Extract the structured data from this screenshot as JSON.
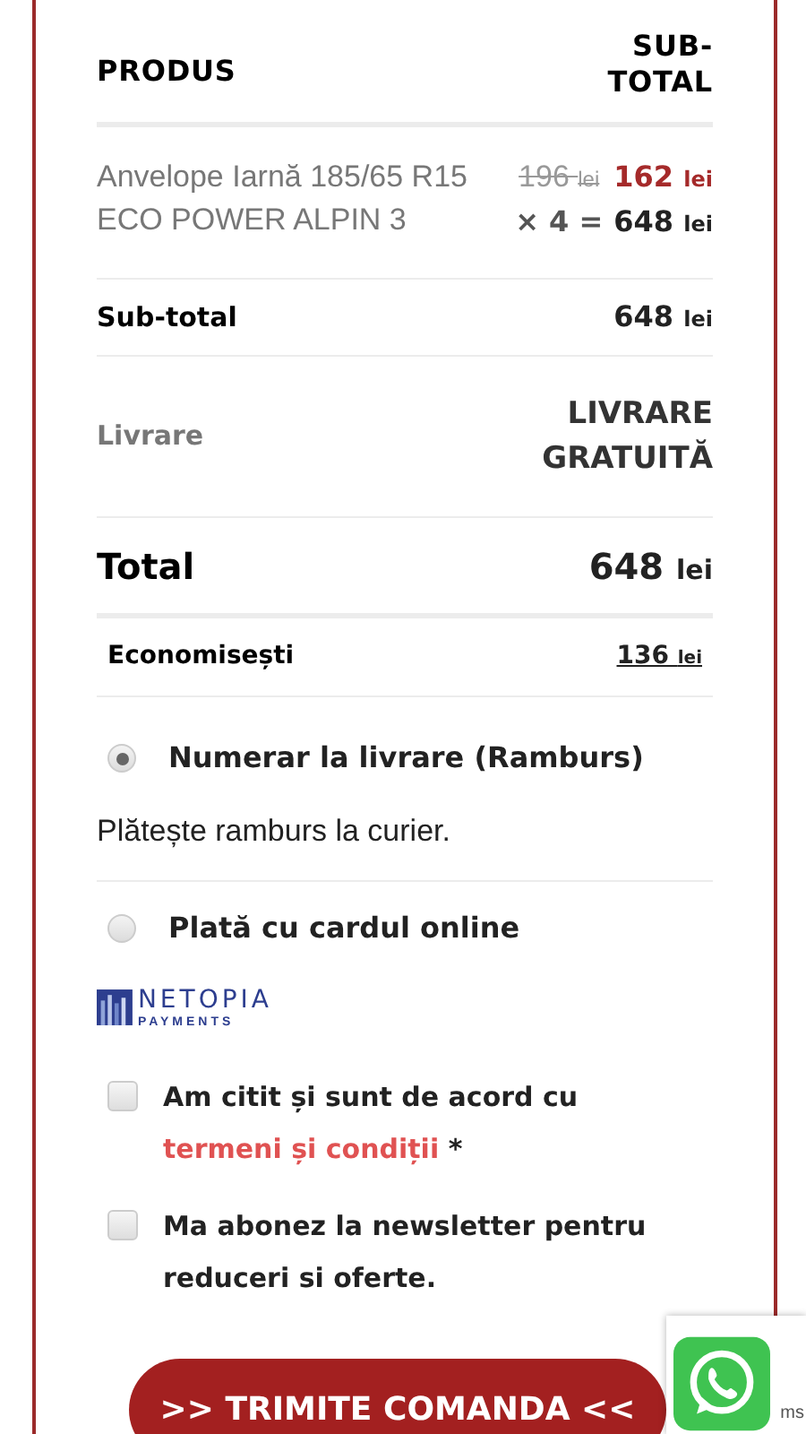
{
  "table": {
    "columns": [
      "PRODUS",
      "SUB-TOTAL"
    ],
    "item": {
      "name": "Anvelope Iarnă 185/65 R15 ECO POWER ALPIN 3",
      "old_price": "196",
      "old_currency": "lei",
      "new_price": "162",
      "new_currency": "lei",
      "quantity": "× 4 =",
      "line_total": "648",
      "line_total_currency": "lei"
    },
    "rows": [
      {
        "kind": "subtotal",
        "label": "Sub-total",
        "value": "648",
        "currency": "lei"
      },
      {
        "kind": "shipping",
        "label": "Livrare",
        "value": "LIVRARE GRATUITĂ"
      },
      {
        "kind": "total",
        "label": "Total",
        "value": "648",
        "currency": "lei"
      },
      {
        "kind": "savings",
        "label": "Economisești",
        "value": "136",
        "currency": "lei"
      }
    ]
  },
  "payment_methods": [
    {
      "label": "Numerar la livrare (Ramburs)",
      "selected": true,
      "description": "Plătește ramburs la curier."
    },
    {
      "label": "Plată cu cardul online",
      "selected": false,
      "logo": {
        "name": "NETOPIA",
        "tagline": "PAYMENTS"
      }
    }
  ],
  "consents": [
    {
      "text": "Am citit și sunt de acord cu ",
      "link": "termeni și condiții",
      "required_mark": "*",
      "checked": false
    },
    {
      "text": "Ma abonez la newsletter pentru reduceri si oferte.",
      "checked": false
    }
  ],
  "submit_button": ">> TRIMITE COMANDA <<",
  "recaptcha_fragment": "ms"
}
